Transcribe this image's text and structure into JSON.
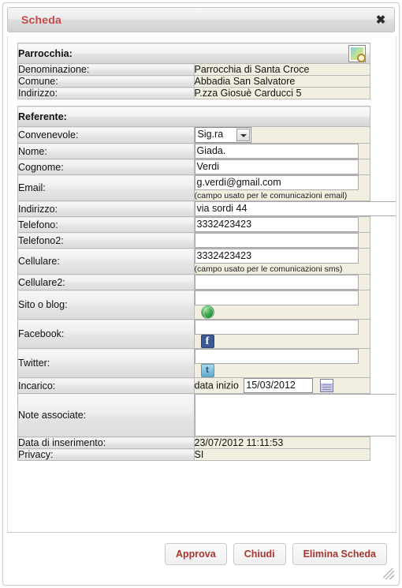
{
  "window": {
    "title": "Scheda",
    "close_label": "✖",
    "title_color": "#c54b4b"
  },
  "sections": {
    "parrocchia": {
      "heading": "Parrocchia:",
      "action_icon": "photo-search-icon",
      "rows": [
        {
          "label": "Denominazione:",
          "value": "Parrocchia di Santa Croce"
        },
        {
          "label": "Comune:",
          "value": "Abbadia San Salvatore"
        },
        {
          "label": "Indirizzo:",
          "value": "P.zza Giosuè Carducci 5"
        }
      ]
    },
    "referente": {
      "heading": "Referente:",
      "fields": {
        "convenevole": {
          "label": "Convenevole:",
          "value": "Sig.ra"
        },
        "nome": {
          "label": "Nome:",
          "value": "Giada."
        },
        "cognome": {
          "label": "Cognome:",
          "value": "Verdi"
        },
        "email": {
          "label": "Email:",
          "value": "g.verdi@gmail.com",
          "hint": "(campo usato per le comunicazioni email)"
        },
        "indirizzo": {
          "label": "Indirizzo:",
          "value": "via sordi 44"
        },
        "telefono": {
          "label": "Telefono:",
          "value": "3332423423"
        },
        "telefono2": {
          "label": "Telefono2:",
          "value": ""
        },
        "cellulare": {
          "label": "Cellulare:",
          "value": "3332423423",
          "hint": "(campo usato per le comunicazioni sms)"
        },
        "cellulare2": {
          "label": "Cellulare2:",
          "value": ""
        },
        "sito": {
          "label": "Sito o blog:",
          "value": "",
          "icon": "globe-icon"
        },
        "facebook": {
          "label": "Facebook:",
          "value": "",
          "icon": "facebook-icon",
          "icon_glyph": "f"
        },
        "twitter": {
          "label": "Twitter:",
          "value": "",
          "icon": "twitter-icon",
          "icon_glyph": "t"
        },
        "incarico": {
          "label": "Incarico:",
          "prefix": "data inizio",
          "value": "15/03/2012",
          "icon": "calendar-icon"
        },
        "note": {
          "label": "Note associate:",
          "value": ""
        },
        "data_inserimento": {
          "label": "Data di inserimento:",
          "value": "23/07/2012 11:11:53"
        },
        "privacy": {
          "label": "Privacy:",
          "value": "SI"
        }
      }
    }
  },
  "footer": {
    "buttons": [
      {
        "label": "Approva",
        "name": "approve-button"
      },
      {
        "label": "Chiudi",
        "name": "close-button"
      },
      {
        "label": "Elimina Scheda",
        "name": "delete-record-button"
      }
    ]
  }
}
